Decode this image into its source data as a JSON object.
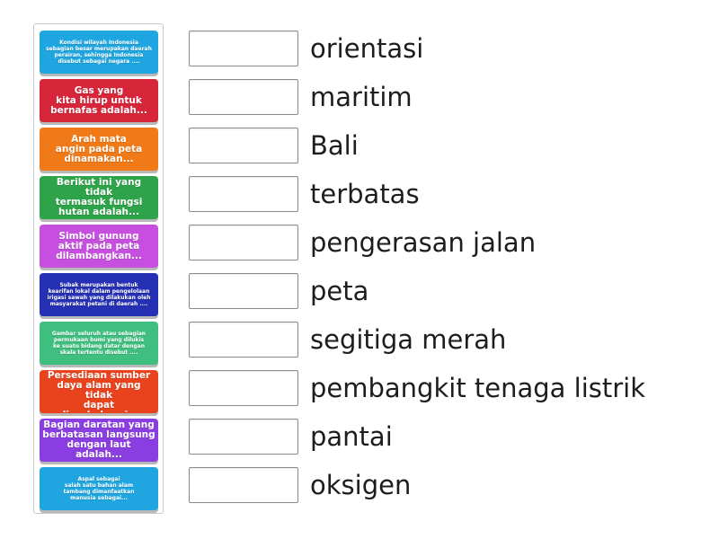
{
  "colors": {
    "blue": "#1fa6e0",
    "red": "#d7263a",
    "orange": "#f07a18",
    "green": "#2ea34a",
    "violet": "#c64fe0",
    "navy": "#2530b5",
    "teal": "#3fbf7f",
    "redorange": "#e8431d",
    "purple": "#8a3de0"
  },
  "tiles": [
    {
      "text": "Kondisi wilayah Indonesia\nsebagian besar merupakan daerah\nperairan, sehingga Indonesia\ndisebut sebagai negara ....",
      "color": "blue",
      "size": "tiny"
    },
    {
      "text": "Gas yang\nkita hirup untuk\nbernafas adalah...",
      "color": "red",
      "size": "med"
    },
    {
      "text": "Arah mata\nangin pada peta\ndinamakan...",
      "color": "orange",
      "size": "med"
    },
    {
      "text": "Berikut ini yang tidak\ntermasuk fungsi\nhutan adalah...",
      "color": "green",
      "size": "med"
    },
    {
      "text": "Simbol gunung\naktif pada peta\ndilambangkan...",
      "color": "violet",
      "size": "med"
    },
    {
      "text": "Subak merupakan bentuk\nkearifan lokal dalam pengelolaan\nirigasi sawah yang dilakukan oleh\nmasyarakat petani di daerah ....",
      "color": "navy",
      "size": "tiny"
    },
    {
      "text": "Gambar seluruh atau sebagian\npermukaan bumi yang dilukis\nke suatu bidang datar dengan\nskala tertentu disebut ....",
      "color": "teal",
      "size": "tiny"
    },
    {
      "text": "Persediaan sumber\ndaya alam yang tidak\ndapat diperbaharui...",
      "color": "redorange",
      "size": "med"
    },
    {
      "text": "Bagian daratan yang\nberbatasan langsung\ndengan laut adalah...",
      "color": "purple",
      "size": "med"
    },
    {
      "text": "Aspal sebagai\nsalah satu bahan alam\ntambang dimanfaatkan\nmanusia sebagai...",
      "color": "blue",
      "size": "tiny"
    }
  ],
  "answers": [
    "orientasi",
    "maritim",
    "Bali",
    "terbatas",
    "pengerasan jalan",
    "peta",
    "segitiga merah",
    "pembangkit tenaga listrik",
    "pantai",
    "oksigen"
  ]
}
